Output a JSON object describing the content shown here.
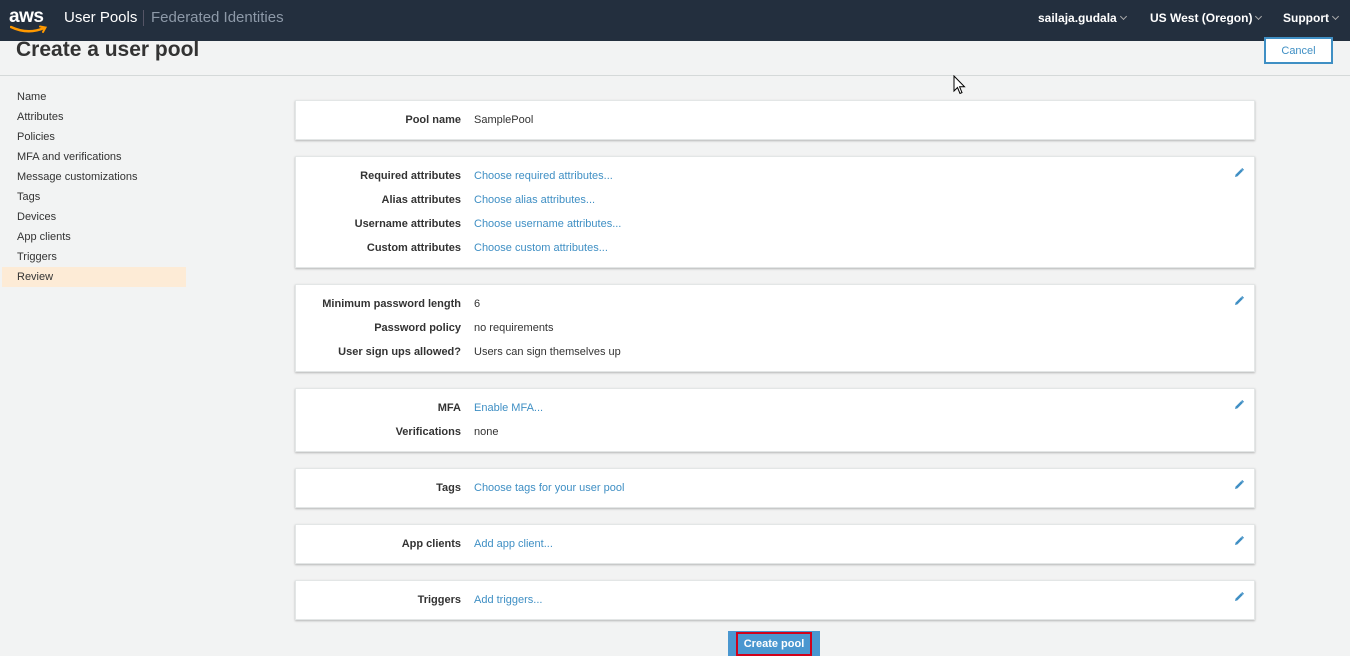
{
  "topnav": {
    "logo_text": "aws",
    "active_link": "User Pools",
    "other_link": "Federated Identities",
    "user": "sailaja.gudala",
    "region": "US West (Oregon)",
    "support": "Support"
  },
  "header": {
    "title": "Create a user pool",
    "cancel_label": "Cancel"
  },
  "sidebar": {
    "items": [
      {
        "label": "Name"
      },
      {
        "label": "Attributes"
      },
      {
        "label": "Policies"
      },
      {
        "label": "MFA and verifications"
      },
      {
        "label": "Message customizations"
      },
      {
        "label": "Tags"
      },
      {
        "label": "Devices"
      },
      {
        "label": "App clients"
      },
      {
        "label": "Triggers"
      },
      {
        "label": "Review"
      }
    ],
    "active_index": 9
  },
  "review": {
    "pool_name": {
      "label": "Pool name",
      "value": "SamplePool"
    },
    "attributes": {
      "required": {
        "label": "Required attributes",
        "link": "Choose required attributes..."
      },
      "alias": {
        "label": "Alias attributes",
        "link": "Choose alias attributes..."
      },
      "username": {
        "label": "Username attributes",
        "link": "Choose username attributes..."
      },
      "custom": {
        "label": "Custom attributes",
        "link": "Choose custom attributes..."
      }
    },
    "policies": {
      "min_length": {
        "label": "Minimum password length",
        "value": "6"
      },
      "policy": {
        "label": "Password policy",
        "value": "no requirements"
      },
      "signups": {
        "label": "User sign ups allowed?",
        "value": "Users can sign themselves up"
      }
    },
    "mfa": {
      "mfa": {
        "label": "MFA",
        "link": "Enable MFA..."
      },
      "verifications": {
        "label": "Verifications",
        "value": "none"
      }
    },
    "tags": {
      "label": "Tags",
      "link": "Choose tags for your user pool"
    },
    "app_clients": {
      "label": "App clients",
      "link": "Add app client..."
    },
    "triggers": {
      "label": "Triggers",
      "link": "Add triggers..."
    }
  },
  "footer": {
    "create_label": "Create pool"
  },
  "icons": {
    "edit": "pencil-icon",
    "logo_smile": "aws-smile-icon"
  },
  "colors": {
    "nav_bg": "#232f3e",
    "link": "#3f8fc4",
    "active_sidebar": "#fdebd6",
    "create_btn": "#4a97d0",
    "highlight_border": "#d0021b"
  }
}
